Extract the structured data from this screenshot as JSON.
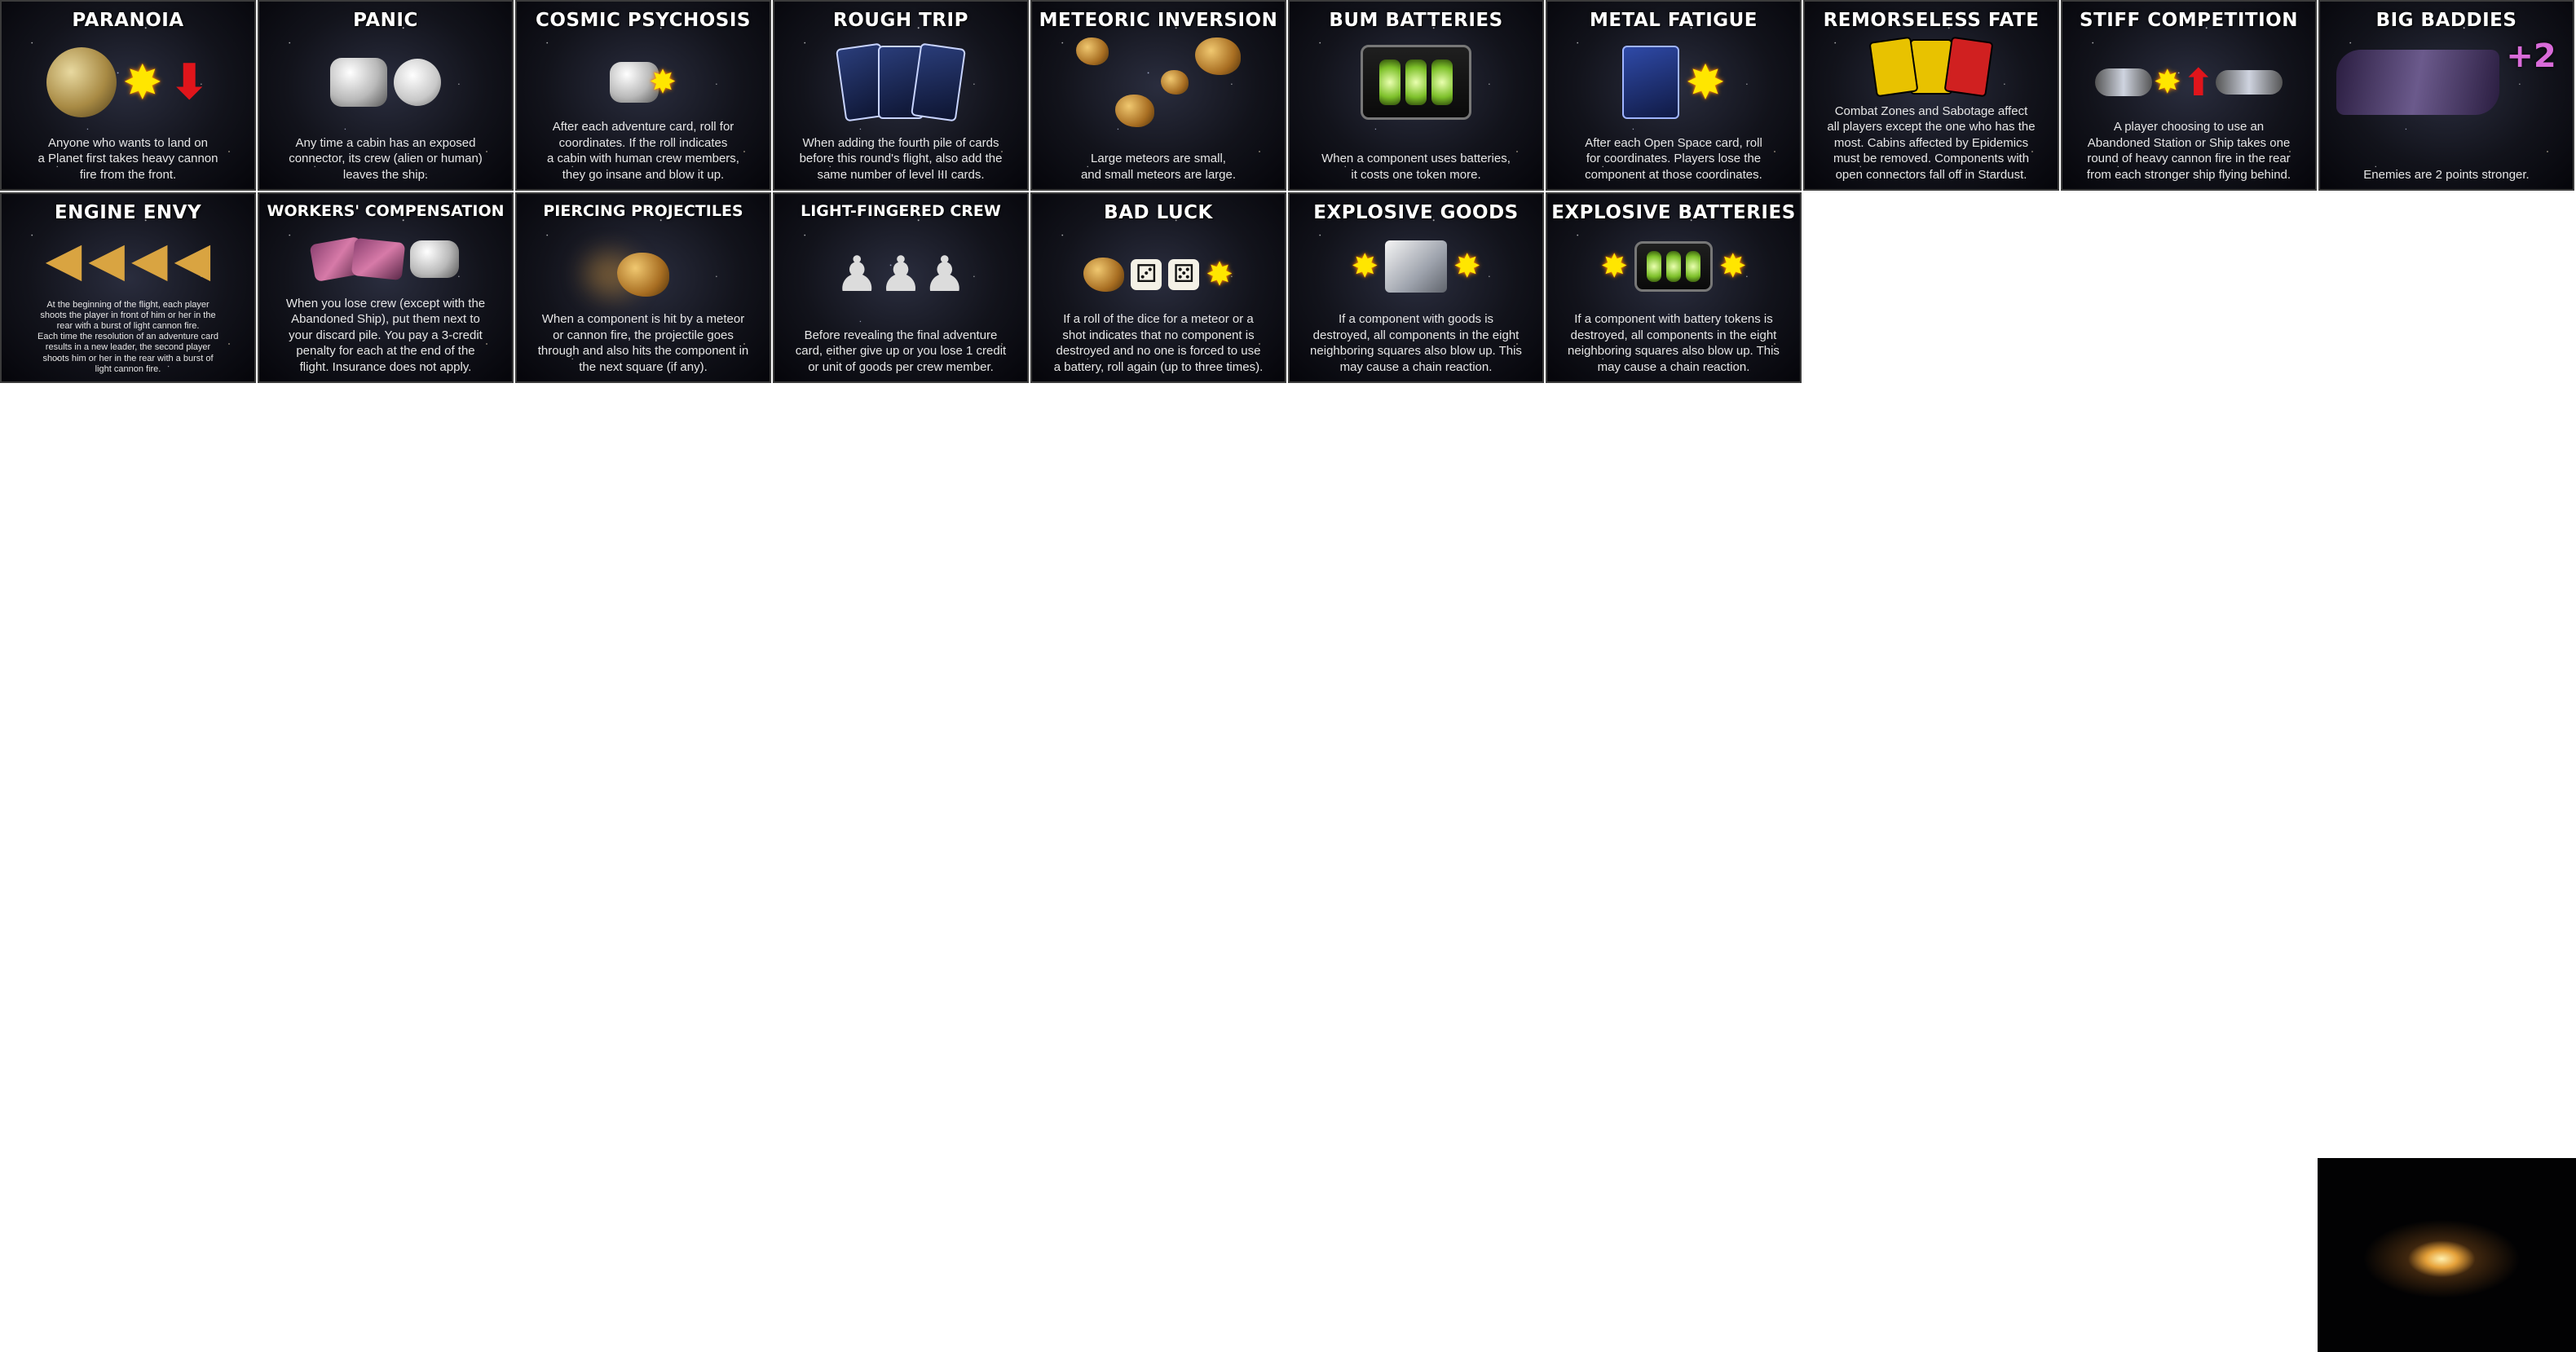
{
  "cards": [
    {
      "title": "Paranoia",
      "text": "Anyone who wants to land on\na Planet first takes heavy cannon\nfire from the front.",
      "art": [
        "planet",
        "explosion",
        "red-arrow"
      ]
    },
    {
      "title": "Panic",
      "text": "Any time a cabin has an exposed\nconnector, its crew (alien or human)\nleaves the ship.",
      "art": [
        "cabin",
        "astronaut"
      ]
    },
    {
      "title": "Cosmic Psychosis",
      "text": "After each adventure card, roll for\ncoordinates. If the roll indicates\na cabin with human crew members,\nthey go insane and blow it up.",
      "art": [
        "cabin",
        "explosion"
      ]
    },
    {
      "title": "Rough Trip",
      "text": "When adding the fourth pile of cards\nbefore this round's flight, also add the\nsame number of level III cards.",
      "art": [
        "card-pile"
      ]
    },
    {
      "title": "Meteoric Inversion",
      "text": "Large meteors are small,\nand small meteors are large.",
      "art": [
        "meteors"
      ]
    },
    {
      "title": "Bum Batteries",
      "text": "When a component uses batteries,\nit costs one token more.",
      "art": [
        "battery"
      ]
    },
    {
      "title": "Metal Fatigue",
      "text": "After each Open Space card, roll\nfor coordinates. Players lose the\ncomponent at those coordinates.",
      "art": [
        "open-space-card",
        "explosion"
      ]
    },
    {
      "title": "Remorseless Fate",
      "text": "Combat Zones and Sabotage affect\nall players except the one who has the\nmost. Cabins affected by Epidemics\nmust be removed. Components with\nopen connectors fall off in Stardust.",
      "art": [
        "hazard-cards"
      ]
    },
    {
      "title": "Stiff Competition",
      "text": "A player choosing to use an\nAbandoned Station or Ship takes one\nround of heavy cannon fire in the rear\nfrom each stronger ship flying behind.",
      "art": [
        "station",
        "explosion",
        "red-arrow",
        "ship"
      ]
    },
    {
      "title": "Big Baddies",
      "text": "Enemies are 2 points stronger.",
      "art": [
        "enemy-ship"
      ],
      "bonus": "+2"
    },
    {
      "title": "Engine Envy",
      "text": "At the beginning of the flight, each player\nshoots the player in front of him or her in the\nrear with a burst of light cannon fire.\nEach time the resolution of an adventure card\nresults in a new leader, the second player\nshoots him or her in the rear with a burst of\nlight cannon fire.",
      "art": [
        "engines"
      ]
    },
    {
      "title": "Workers' Compensation",
      "text": "When you lose crew (except with the\nAbandoned Ship), put them next to\nyour discard pile. You pay a 3-credit\npenalty for each at the end of the\nflight. Insurance does not apply.",
      "art": [
        "cargo",
        "crew"
      ]
    },
    {
      "title": "Piercing Projectiles",
      "text": "When a component is hit by a meteor\nor cannon fire, the projectile goes\nthrough and also hits the component in\nthe next square (if any).",
      "art": [
        "meteor"
      ]
    },
    {
      "title": "Light-Fingered Crew",
      "text": "Before revealing the final adventure\ncard, either give up or you lose 1 credit\nor unit of goods per crew member.",
      "art": [
        "crew-group"
      ]
    },
    {
      "title": "Bad Luck",
      "text": "If a roll of the dice for a meteor or a\nshot indicates that no component is\ndestroyed and no one is forced to use\na battery, roll again (up to three times).",
      "art": [
        "meteors",
        "dice",
        "explosion"
      ]
    },
    {
      "title": "Explosive Goods",
      "text": "If a component with goods is\ndestroyed, all components in the eight\nneighboring squares also blow up. This\nmay cause a chain reaction.",
      "art": [
        "goods",
        "explosion"
      ]
    },
    {
      "title": "Explosive Batteries",
      "text": "If a component with battery tokens is\ndestroyed, all components in the eight\nneighboring squares also blow up. This\nmay cause a chain reaction.",
      "art": [
        "battery",
        "explosion"
      ]
    }
  ],
  "card_back": {
    "art": "galaxy"
  },
  "colors": {
    "card_bg": "#0b0c12",
    "title": "#ffffff",
    "text": "#e6e6e6",
    "explosion": "#ffe600",
    "arrow": "#e0151b"
  }
}
